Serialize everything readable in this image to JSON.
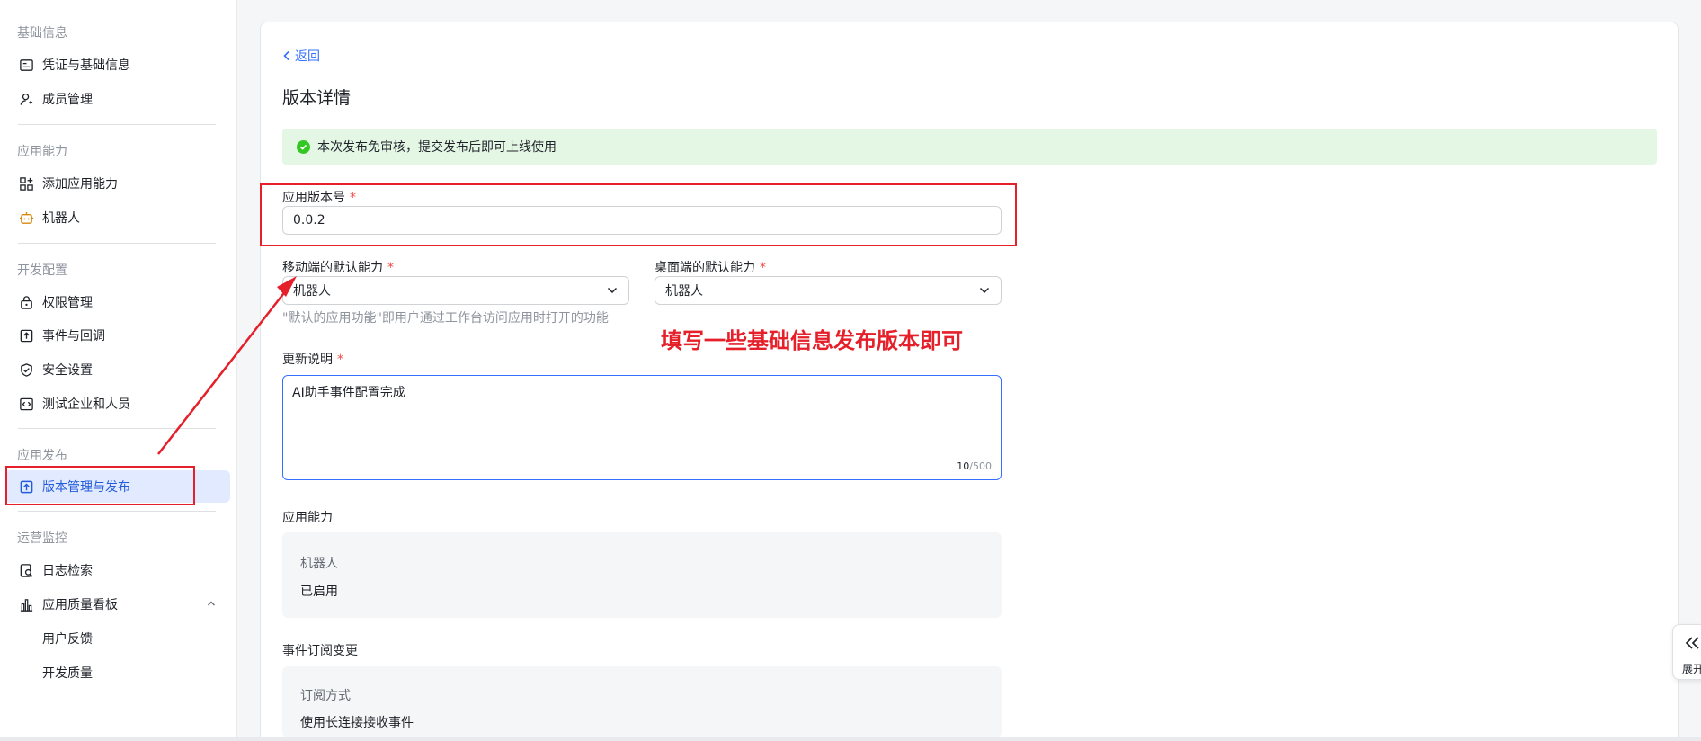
{
  "sidebar": {
    "sections": [
      {
        "title": "基础信息",
        "items": [
          {
            "label": "凭证与基础信息",
            "icon": "credential-icon"
          },
          {
            "label": "成员管理",
            "icon": "member-add-icon"
          }
        ]
      },
      {
        "title": "应用能力",
        "items": [
          {
            "label": "添加应用能力",
            "icon": "app-grid-icon"
          },
          {
            "label": "机器人",
            "icon": "robot-icon"
          }
        ]
      },
      {
        "title": "开发配置",
        "items": [
          {
            "label": "权限管理",
            "icon": "lock-icon"
          },
          {
            "label": "事件与回调",
            "icon": "event-icon"
          },
          {
            "label": "安全设置",
            "icon": "shield-icon"
          },
          {
            "label": "测试企业和人员",
            "icon": "code-icon"
          }
        ]
      },
      {
        "title": "应用发布",
        "items": [
          {
            "label": "版本管理与发布",
            "icon": "upload-icon"
          }
        ]
      },
      {
        "title": "运营监控",
        "items": [
          {
            "label": "日志检索",
            "icon": "log-search-icon"
          },
          {
            "label": "应用质量看板",
            "icon": "bar-chart-icon"
          },
          {
            "label": "用户反馈"
          },
          {
            "label": "开发质量"
          }
        ]
      }
    ]
  },
  "main": {
    "back_label": "返回",
    "title": "版本详情",
    "notice": "本次发布免审核，提交发布后即可上线使用",
    "version": {
      "label": "应用版本号",
      "required": "*",
      "value": "0.0.2"
    },
    "mobile_default": {
      "label": "移动端的默认能力",
      "required": "*",
      "value": "机器人"
    },
    "desktop_default": {
      "label": "桌面端的默认能力",
      "required": "*",
      "value": "机器人"
    },
    "default_hint": "\"默认的应用功能\"即用户通过工作台访问应用时打开的功能",
    "update_notes": {
      "label": "更新说明",
      "required": "*",
      "value": "AI助手事件配置完成",
      "count": "10",
      "max": "/500"
    },
    "capabilities": {
      "title": "应用能力",
      "name": "机器人",
      "status": "已启用"
    },
    "event_change": {
      "title": "事件订阅变更",
      "method_label": "订阅方式",
      "method_value": "使用长连接接收事件"
    }
  },
  "annotation": {
    "text": "填写一些基础信息发布版本即可"
  },
  "float_button": {
    "label": "展开"
  },
  "colors": {
    "primary": "#3370ff",
    "annotation_red": "#e5202a",
    "success": "#34c724",
    "notice_bg": "#e4f7e5"
  }
}
